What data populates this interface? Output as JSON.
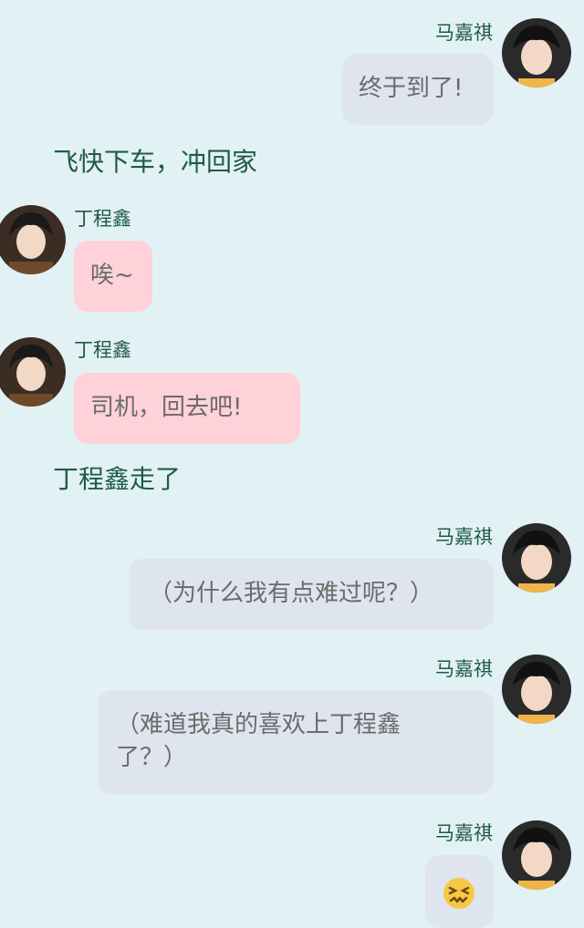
{
  "messages": [
    {
      "sender": "马嘉祺",
      "text": "终于到了!"
    },
    {
      "narration": "飞快下车，冲回家"
    },
    {
      "sender": "丁程鑫",
      "text": "唉~"
    },
    {
      "sender": "丁程鑫",
      "text": "司机，回去吧!"
    },
    {
      "narration": "丁程鑫走了"
    },
    {
      "sender": "马嘉祺",
      "text": "（为什么我有点难过呢？）"
    },
    {
      "sender": "马嘉祺",
      "text_line1": "（难道我真的喜欢上丁程鑫",
      "text_line2": "了？）"
    },
    {
      "sender": "马嘉祺",
      "emoji": "😖"
    }
  ],
  "colors": {
    "background": "#e2f1f4",
    "name_text": "#1f5a4c",
    "bubble_grey": "#dfe5ee",
    "bubble_pink": "#ffd1d9",
    "bubble_text": "#6b6b6b"
  },
  "icons": [
    "avatar-ma-jiaqi",
    "avatar-ding-chengxin",
    "confounded-face-emoji"
  ]
}
